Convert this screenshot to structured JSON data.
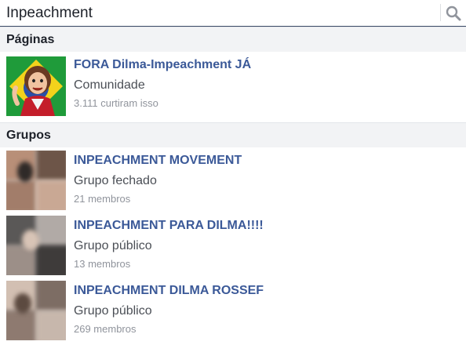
{
  "search": {
    "value": "Inpeachment",
    "icon": "search-icon"
  },
  "sections": {
    "pages": {
      "header": "Páginas",
      "items": [
        {
          "title": "FORA Dilma-Impeachment JÁ",
          "category": "Comunidade",
          "meta": "3.111 curtiram isso"
        }
      ]
    },
    "groups": {
      "header": "Grupos",
      "items": [
        {
          "title": "INPEACHMENT MOVEMENT",
          "category": "Grupo fechado",
          "meta": "21 membros"
        },
        {
          "title": "INPEACHMENT PARA DILMA!!!!",
          "category": "Grupo público",
          "meta": "13 membros"
        },
        {
          "title": "INPEACHMENT DILMA ROSSEF",
          "category": "Grupo público",
          "meta": "269 membros"
        }
      ]
    }
  },
  "colors": {
    "link": "#3b5998",
    "section_bg": "#f2f3f5",
    "text": "#1d2129",
    "meta": "#90949c"
  }
}
